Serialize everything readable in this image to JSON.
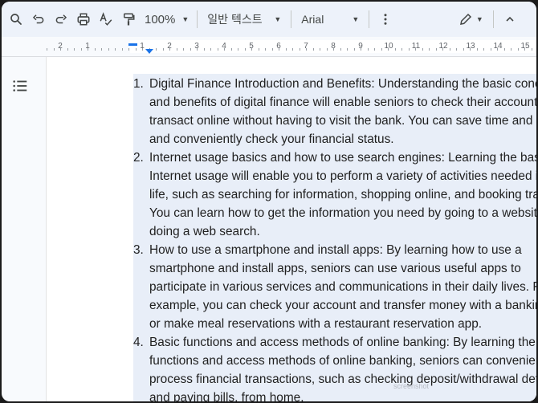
{
  "toolbar": {
    "zoom": "100%",
    "style": "일반 텍스트",
    "font": "Arial"
  },
  "ruler": {
    "labels": [
      "2",
      "1",
      "1",
      "2",
      "3",
      "4",
      "5",
      "6",
      "7",
      "8",
      "9",
      "10",
      "11",
      "12",
      "13",
      "14",
      "15"
    ]
  },
  "document": {
    "items": [
      {
        "number": "1.",
        "lines": [
          "Digital Finance Introduction and Benefits: Understanding the basic concep",
          "and benefits of digital finance will enable seniors to check their accounts a",
          "transact online without having to visit the bank. You can save time and effo",
          "and conveniently check your financial status."
        ]
      },
      {
        "number": "2.",
        "lines": [
          "Internet usage basics and how to use search engines: Learning the basics",
          "Internet usage will enable you to perform a variety of activities needed in d",
          "life, such as searching for information, shopping online, and booking travel",
          "You can learn how to get the information you need by going to a website o",
          "doing a web search."
        ]
      },
      {
        "number": "3.",
        "lines": [
          "How to use a smartphone and install apps: By learning how to use a",
          "smartphone and install apps, seniors can use various useful apps to",
          "participate in various services and communications in their daily lives. For",
          "example, you can check your account and transfer money with a banking a",
          "or make meal reservations with a restaurant reservation app."
        ]
      },
      {
        "number": "4.",
        "lines": [
          "Basic functions and access methods of online banking: By learning the",
          "functions and access methods of online banking, seniors can conveniently",
          "process financial transactions, such as checking deposit/withdrawal details",
          "and paying bills, from home."
        ]
      }
    ]
  },
  "watermark": "screenshot"
}
